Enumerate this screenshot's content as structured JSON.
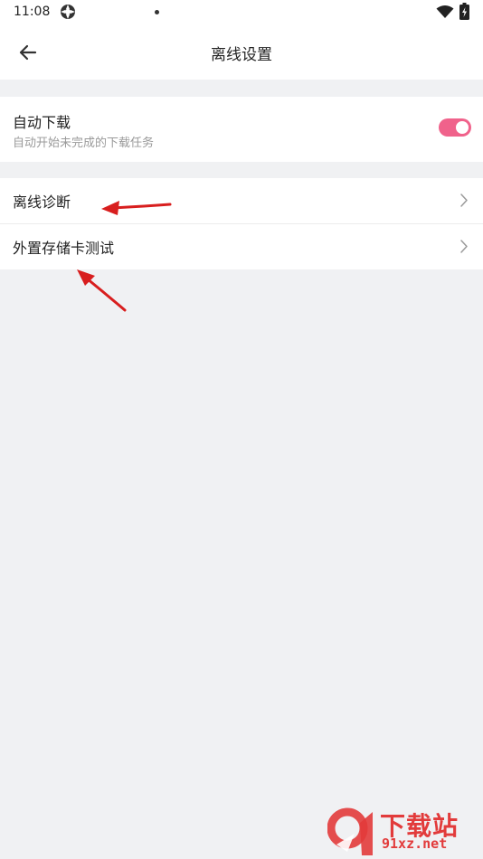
{
  "status_bar": {
    "time": "11:08",
    "icons": [
      "vpn-icon",
      "notification-dot-icon",
      "wifi-icon",
      "battery-icon"
    ]
  },
  "header": {
    "title": "离线设置",
    "back_icon": "arrow-left-icon"
  },
  "auto_download": {
    "title": "自动下载",
    "subtitle": "自动开始未完成的下载任务",
    "enabled": true
  },
  "nav_items": [
    {
      "label": "离线诊断",
      "icon": "chevron-right-icon"
    },
    {
      "label": "外置存储卡测试",
      "icon": "chevron-right-icon"
    }
  ],
  "colors": {
    "accent": "#f0628b",
    "background": "#f0f1f3",
    "surface": "#ffffff",
    "annotation": "#d81e1e"
  },
  "watermark": {
    "brand": "91",
    "name": "下载站",
    "domain": "91xz.net"
  }
}
